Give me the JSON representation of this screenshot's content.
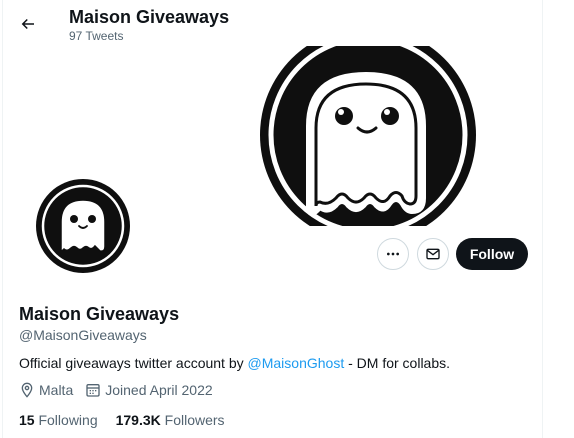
{
  "header": {
    "title": "Maison Giveaways",
    "tweet_count": "97 Tweets"
  },
  "actions": {
    "follow_label": "Follow"
  },
  "profile": {
    "display_name": "Maison Giveaways",
    "handle": "@MaisonGiveaways",
    "bio_before": "Official giveaways twitter account by ",
    "bio_mention": "@MaisonGhost",
    "bio_after": " - DM for collabs.",
    "location": "Malta",
    "joined": "Joined April 2022",
    "following_count": "15",
    "following_label": "Following",
    "followers_count": "179.3K",
    "followers_label": "Followers"
  },
  "colors": {
    "accent": "#1d9bf0",
    "text_primary": "#0f1419",
    "text_secondary": "#536471",
    "follow_bg": "#0f1419"
  },
  "icons": {
    "back": "arrow-left-icon",
    "more": "more-dots-icon",
    "message": "envelope-icon",
    "location": "location-pin-icon",
    "calendar": "calendar-icon"
  }
}
